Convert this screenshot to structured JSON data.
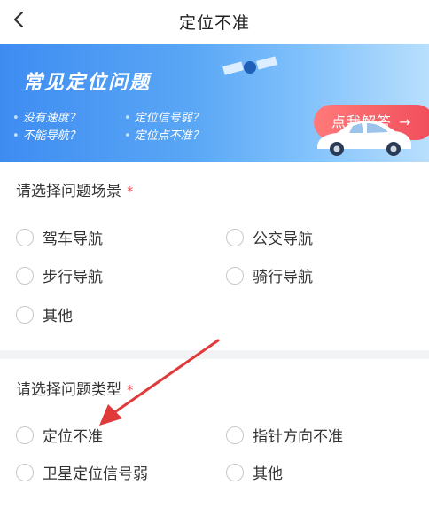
{
  "nav": {
    "back_icon": "chevron-left-icon",
    "title": "定位不准"
  },
  "banner": {
    "title": "常见定位问题",
    "questions": [
      "没有速度？",
      "定位信号弱？",
      "不能导航？",
      "定位点不准？"
    ],
    "cta_label": "点我解答",
    "cta_arrow": "→",
    "cta_color": "#f14d5a",
    "background_color": "#4a98f4"
  },
  "scene_section": {
    "label": "请选择问题场景",
    "required_mark": "*",
    "options": [
      "驾车导航",
      "公交导航",
      "步行导航",
      "骑行导航",
      "其他"
    ]
  },
  "type_section": {
    "label": "请选择问题类型",
    "required_mark": "*",
    "options": [
      "定位不准",
      "指针方向不准",
      "卫星定位信号弱",
      "其他"
    ]
  },
  "annotation": {
    "arrow_color": "#e03a3a"
  }
}
